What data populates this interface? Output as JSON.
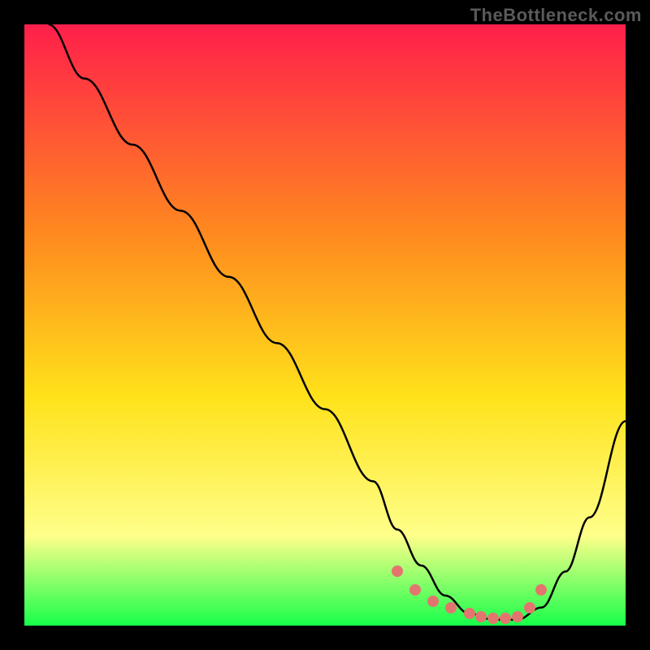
{
  "watermark": "TheBottleneck.com",
  "colors": {
    "dot": "#e2766f",
    "curve": "#000000",
    "frame": "#000000",
    "gradient_top": "#ff1f4b",
    "gradient_mid1": "#ff8a1f",
    "gradient_mid2": "#ffe21a",
    "gradient_mid3": "#ffff8a",
    "gradient_bottom": "#17ff4a"
  },
  "chart_data": {
    "type": "line",
    "title": "",
    "xlabel": "",
    "ylabel": "",
    "xlim": [
      0,
      100
    ],
    "ylim": [
      0,
      100
    ],
    "grid": false,
    "series": [
      {
        "name": "bottleneck_curve",
        "x": [
          4,
          10,
          18,
          26,
          34,
          42,
          50,
          58,
          62,
          66,
          70,
          74,
          78,
          82,
          86,
          90,
          94,
          100
        ],
        "y": [
          100,
          91,
          80,
          69,
          58,
          47,
          36,
          24,
          16,
          10,
          5,
          2,
          1,
          1,
          3,
          9,
          18,
          34
        ]
      }
    ],
    "flat_region_dots": {
      "name": "optimal_range_markers",
      "x": [
        62,
        65,
        68,
        71,
        74,
        76,
        78,
        80,
        82,
        84,
        86
      ],
      "y": [
        9,
        6,
        4,
        3,
        2,
        1.5,
        1.2,
        1.2,
        1.5,
        3,
        6
      ]
    },
    "gradient_stops": [
      {
        "pos": 0.0,
        "color": "#ff1f4b"
      },
      {
        "pos": 0.35,
        "color": "#ff8a1f"
      },
      {
        "pos": 0.62,
        "color": "#ffe21a"
      },
      {
        "pos": 0.85,
        "color": "#ffff8a"
      },
      {
        "pos": 1.0,
        "color": "#17ff4a"
      }
    ]
  }
}
